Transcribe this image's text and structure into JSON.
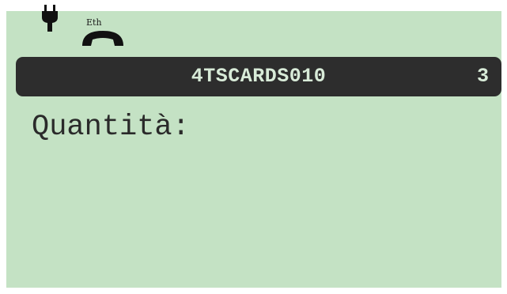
{
  "status_bar": {
    "power_icon": "plug-icon",
    "connection_label": "Eth",
    "connection_icon": "phone-handset-icon"
  },
  "title_bar": {
    "item_code": "4TSCARDS010",
    "count": "3"
  },
  "main": {
    "prompt": "Quantità:"
  },
  "colors": {
    "screen_background": "#c4e2c4",
    "title_bar_background": "#2d2d2d",
    "title_bar_text": "#d8ebd8",
    "text": "#2a2a2a"
  }
}
